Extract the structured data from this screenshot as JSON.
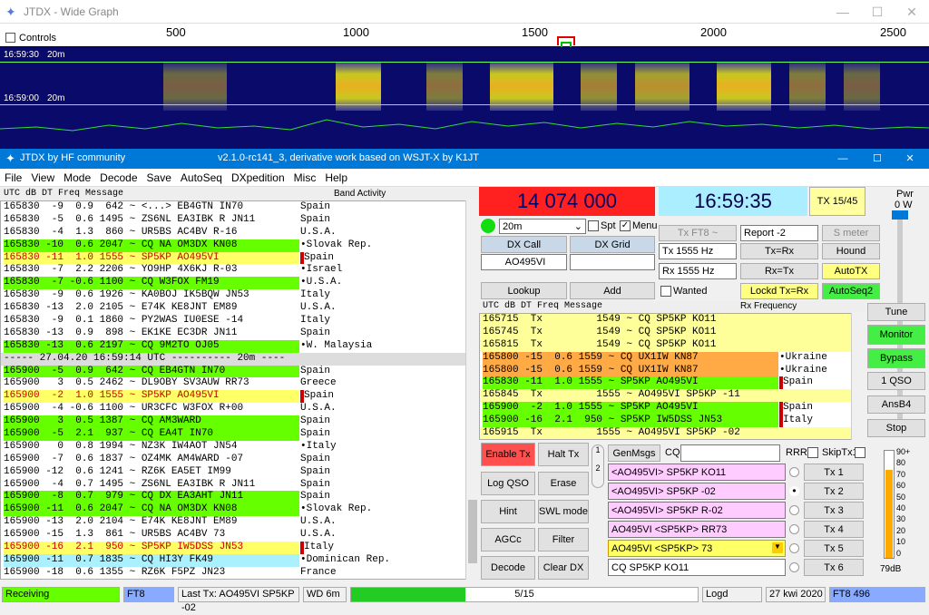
{
  "wide_graph": {
    "title": "JTDX - Wide Graph",
    "controls_label": "Controls",
    "ticks": [
      "500",
      "1000",
      "1500",
      "2000",
      "2500"
    ],
    "time1": "16:59:30",
    "band1": "20m",
    "time2": "16:59:00",
    "band2": "20m"
  },
  "main": {
    "title": "JTDX  by HF community",
    "subtitle": "v2.1.0-rc141_3, derivative work based on WSJT-X by K1JT"
  },
  "menu": [
    "File",
    "View",
    "Mode",
    "Decode",
    "Save",
    "AutoSeq",
    "DXpedition",
    "Misc",
    "Help"
  ],
  "band_activity": {
    "header": "UTC    dB   DT Freq    Message",
    "title": "Band Activity",
    "rows": [
      {
        "t": "165830  -9  0.9  642 ~ <...> EB4GTN IN70",
        "c": "Spain",
        "s": "n"
      },
      {
        "t": "165830  -5  0.6 1495 ~ ZS6NL EA3IBK R JN11",
        "c": "Spain",
        "s": "n"
      },
      {
        "t": "165830  -4  1.3  860 ~ UR5BS AC4BV R-16",
        "c": "U.S.A.",
        "s": "n"
      },
      {
        "t": "165830 -10  0.6 2047 ~ CQ NA OM3DX KN08",
        "c": "•Slovak Rep.",
        "s": "cq"
      },
      {
        "t": "165830 -11  1.0 1555 ~ SP5KP AO495VI",
        "c": "Spain",
        "s": "my"
      },
      {
        "t": "165830  -7  2.2 2206 ~ YO9HP 4X6KJ R-03",
        "c": "•Israel",
        "s": "n"
      },
      {
        "t": "165830  -7 -0.6 1100 ~ CQ W3FOX FM19",
        "c": "•U.S.A.",
        "s": "cq"
      },
      {
        "t": "165830  -9  0.6 1926 ~ KA0BOJ IK5BQW JN53",
        "c": "Italy",
        "s": "n"
      },
      {
        "t": "165830 -13  2.0 2105 ~ E74K KE8JNT EM89",
        "c": "U.S.A.",
        "s": "n"
      },
      {
        "t": "165830  -9  0.1 1860 ~ PY2WAS IU0ESE -14",
        "c": "Italy",
        "s": "n"
      },
      {
        "t": "165830 -13  0.9  898 ~ EK1KE EC3DR JN11",
        "c": "Spain",
        "s": "n"
      },
      {
        "t": "165830 -13  0.6 2197 ~ CQ 9M2TO OJ05",
        "c": "•W. Malaysia",
        "s": "cq"
      },
      {
        "t": "----- 27.04.20 16:59:14 UTC ---------- 20m ----",
        "c": "",
        "s": "sep"
      },
      {
        "t": "165900  -5  0.9  642 ~ CQ EB4GTN IN70",
        "c": "Spain",
        "s": "cq"
      },
      {
        "t": "165900   3  0.5 2462 ~ DL9OBY SV3AUW RR73",
        "c": "Greece",
        "s": "n"
      },
      {
        "t": "165900  -2  1.0 1555 ~ SP5KP AO495VI",
        "c": "Spain",
        "s": "my"
      },
      {
        "t": "165900  -4 -0.6 1100 ~ UR3CFC W3FOX R+00",
        "c": "U.S.A.",
        "s": "n"
      },
      {
        "t": "165900   3  0.5 1387 ~ CQ AM3WARD",
        "c": "Spain",
        "s": "cq"
      },
      {
        "t": "165900  -5  2.1  937 ~ CQ EA4T IN70",
        "c": "Spain",
        "s": "cq"
      },
      {
        "t": "165900   0  0.8 1994 ~ NZ3K IW4AOT JN54",
        "c": "•Italy",
        "s": "n"
      },
      {
        "t": "165900  -7  0.6 1837 ~ OZ4MK AM4WARD -07",
        "c": "Spain",
        "s": "n"
      },
      {
        "t": "165900 -12  0.6 1241 ~ RZ6K EA5ET IM99",
        "c": "Spain",
        "s": "n"
      },
      {
        "t": "165900  -4  0.7 1495 ~ ZS6NL EA3IBK R JN11",
        "c": "Spain",
        "s": "n"
      },
      {
        "t": "165900  -8  0.7  979 ~ CQ DX EA3AHT JN11",
        "c": "Spain",
        "s": "cq"
      },
      {
        "t": "165900 -11  0.6 2047 ~ CQ NA OM3DX KN08",
        "c": "•Slovak Rep.",
        "s": "cq"
      },
      {
        "t": "165900 -13  2.0 2104 ~ E74K KE8JNT EM89",
        "c": "U.S.A.",
        "s": "n"
      },
      {
        "t": "165900 -15  1.3  861 ~ UR5BS AC4BV 73",
        "c": "U.S.A.",
        "s": "n"
      },
      {
        "t": "165900 -16  2.1  950 ~ SP5KP IW5DSS JN53",
        "c": "Italy",
        "s": "my"
      },
      {
        "t": "165900 -11  0.7 1835 ~ CQ HI3Y FK49",
        "c": "•Dominican Rep.",
        "s": "cq2"
      },
      {
        "t": "165900 -18  0.6 1355 ~ RZ6K F5PZ JN23",
        "c": "France",
        "s": "n"
      }
    ]
  },
  "freq_display": "14 074 000",
  "time_display": "16:59:35",
  "tx_slot": "TX 15/45",
  "pwr_label": "Pwr",
  "pwr_value": "0 W",
  "band_select": "20m",
  "spt_label": "Spt",
  "menu_label": "Menu",
  "dx_call_label": "DX Call",
  "dx_grid_label": "DX Grid",
  "dx_call_value": "AO495VI",
  "dx_grid_value": "",
  "tx_ft8_btn": "Tx FT8 ~",
  "report_value": "Report -2",
  "smeter_label": "S meter",
  "tx_hz": "Tx  1555  Hz",
  "rx_hz": "Rx  1555  Hz",
  "tx_eq_rx": "Tx=Rx",
  "rx_eq_tx": "Rx=Tx",
  "hound": "Hound",
  "autotx": "AutoTX",
  "lookup": "Lookup",
  "add": "Add",
  "wanted": "Wanted",
  "lockd": "Lockd Tx=Rx",
  "autoseq2": "AutoSeq2",
  "rx_freq": {
    "header": "UTC    dB   DT Freq    Message",
    "title": "Rx Frequency",
    "rows": [
      {
        "t": "165715  Tx         1549 ~ CQ SP5KP KO11",
        "c": "",
        "s": "rxf"
      },
      {
        "t": "165745  Tx         1549 ~ CQ SP5KP KO11",
        "c": "",
        "s": "rxf"
      },
      {
        "t": "165815  Tx         1549 ~ CQ SP5KP KO11",
        "c": "",
        "s": "rxf"
      },
      {
        "t": "165800 -15  0.6 1559 ~ CQ UX1IW KN87",
        "c": "•Ukraine",
        "s": "or"
      },
      {
        "t": "165800 -15  0.6 1559 ~ CQ UX1IW KN87",
        "c": "•Ukraine",
        "s": "or"
      },
      {
        "t": "165830 -11  1.0 1555 ~ SP5KP AO495VI",
        "c": "Spain",
        "s": "cqr"
      },
      {
        "t": "165845  Tx         1555 ~ AO495VI SP5KP -11",
        "c": "",
        "s": "rxf"
      },
      {
        "t": "165900  -2  1.0 1555 ~ SP5KP AO495VI",
        "c": "Spain",
        "s": "cqr"
      },
      {
        "t": "165900 -16  2.1  950 ~ SP5KP IW5DSS JN53",
        "c": "Italy",
        "s": "cqr"
      },
      {
        "t": "165915  Tx         1555 ~ AO495VI SP5KP -02",
        "c": "",
        "s": "rxf"
      }
    ]
  },
  "side_buttons": [
    "Tune",
    "Monitor",
    "Bypass",
    "1 QSO",
    "AnsB4",
    "Stop"
  ],
  "ctl_buttons": [
    "Enable Tx",
    "Halt Tx",
    "Log QSO",
    "Erase",
    "Hint",
    "SWL mode",
    "AGCc",
    "Filter",
    "Decode",
    "Clear DX"
  ],
  "genmsgs": "GenMsgs",
  "cq_label": "CQ",
  "rrr": "RRR",
  "skiptx1": "SkipTx1",
  "tx_msgs": [
    "<AO495VI> SP5KP KO11",
    "<AO495VI> SP5KP -02",
    "<AO495VI> SP5KP R-02",
    "AO495VI <SP5KP> RR73",
    "AO495VI <SP5KP> 73",
    "CQ SP5KP KO11"
  ],
  "tx_btns": [
    "Tx 1",
    "Tx 2",
    "Tx 3",
    "Tx 4",
    "Tx 5",
    "Tx 6"
  ],
  "meter_ticks": [
    "90+",
    "80",
    "70",
    "60",
    "50",
    "40",
    "30",
    "20",
    "10",
    "0"
  ],
  "meter_db": "79dB",
  "status": {
    "receiving": "Receiving",
    "mode": "FT8",
    "last_tx": "Last Tx: AO495VI SP5KP -02",
    "wd": "WD 6m",
    "progress_text": "5/15",
    "progress": 0.33,
    "logd": "Logd",
    "date": "27 kwi 2020",
    "mode2": "FT8  496"
  },
  "colors": {
    "cq": "#66ff00",
    "my_call": "#ffff66",
    "freq_bg": "#ff2020",
    "time_bg": "#aaeeff",
    "accent": "#0078d7"
  }
}
